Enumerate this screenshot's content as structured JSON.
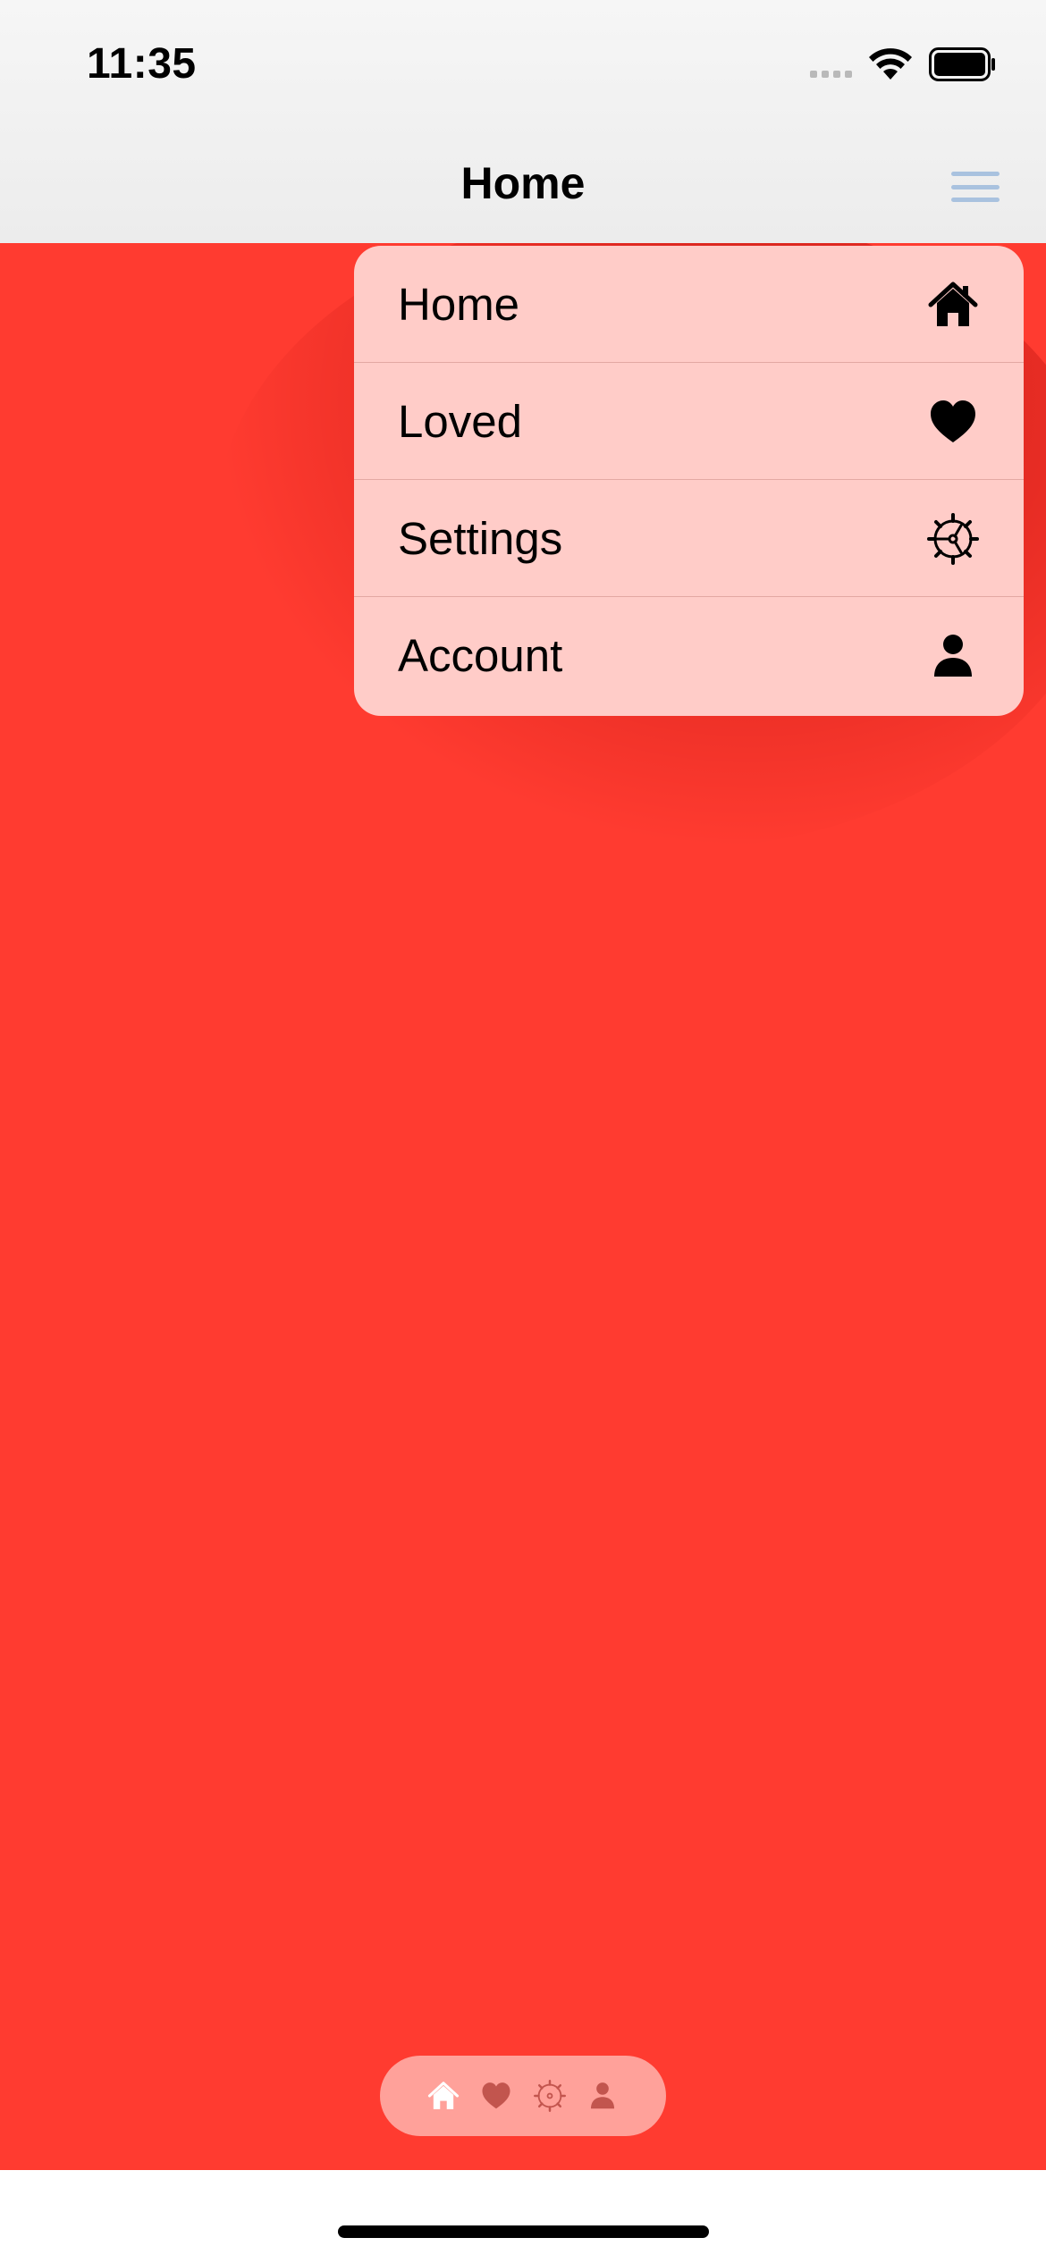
{
  "status_bar": {
    "time": "11:35",
    "icons": [
      "cellular-signal-icon",
      "wifi-icon",
      "battery-icon"
    ]
  },
  "nav_bar": {
    "title": "Home",
    "menu_button_icon": "hamburger-menu-icon"
  },
  "menu": {
    "items": [
      {
        "label": "Home",
        "icon": "house-icon"
      },
      {
        "label": "Loved",
        "icon": "heart-icon"
      },
      {
        "label": "Settings",
        "icon": "gear-icon"
      },
      {
        "label": "Account",
        "icon": "person-icon"
      }
    ]
  },
  "tab_bar": {
    "items": [
      {
        "icon": "house-icon",
        "selected": true
      },
      {
        "icon": "heart-icon",
        "selected": false
      },
      {
        "icon": "gear-icon",
        "selected": false
      },
      {
        "icon": "person-icon",
        "selected": false
      }
    ]
  },
  "colors": {
    "background": "#ff3b30",
    "menu_background": "#ffccc8",
    "nav_bar": "#f2f2f2",
    "hamburger": "#a9c2df",
    "tab_bar": "#ffa19a",
    "tab_selected": "#ffffff",
    "tab_unselected": "#c2554e"
  }
}
